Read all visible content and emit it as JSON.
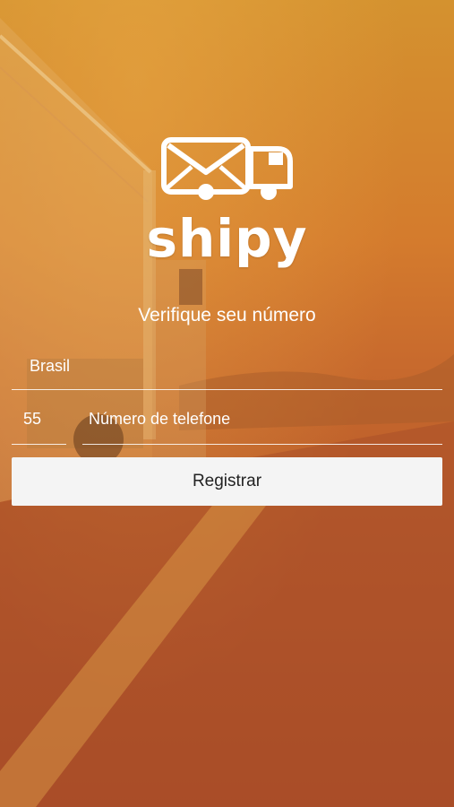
{
  "app": {
    "brand": "shipy",
    "logo_icon": "envelope-truck-icon"
  },
  "verify": {
    "title": "Verifique seu número",
    "country_value": "Brasil",
    "country_code_value": "55",
    "phone_placeholder": "Número de telefone",
    "register_label": "Registrar"
  },
  "colors": {
    "background_orange": "#c86a2c",
    "button_bg": "#f4f4f4",
    "text": "#ffffff"
  }
}
